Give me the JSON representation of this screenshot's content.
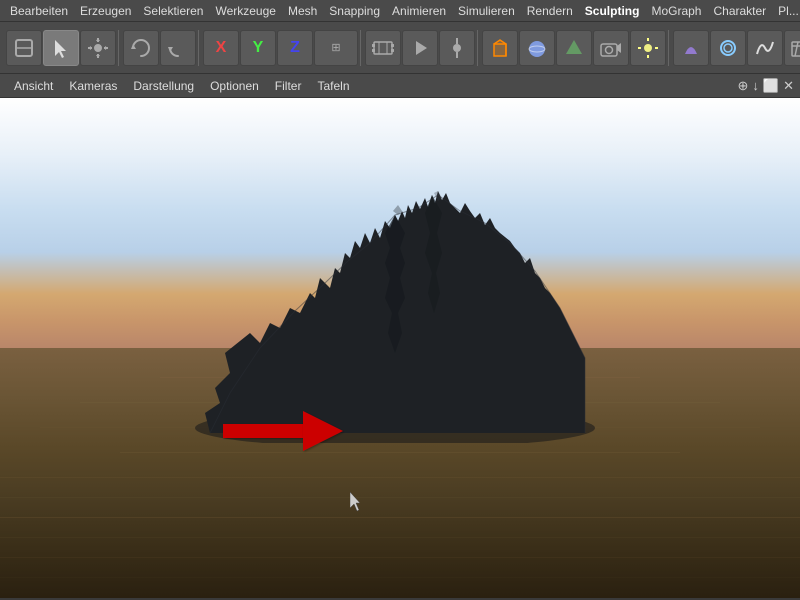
{
  "menubar": {
    "items": [
      {
        "label": "Bearbeiten",
        "id": "bearbeiten"
      },
      {
        "label": "Erzeugen",
        "id": "erzeugen"
      },
      {
        "label": "Selektieren",
        "id": "selektieren"
      },
      {
        "label": "Werkzeuge",
        "id": "werkzeuge"
      },
      {
        "label": "Mesh",
        "id": "mesh"
      },
      {
        "label": "Snapping",
        "id": "snapping"
      },
      {
        "label": "Animieren",
        "id": "animieren"
      },
      {
        "label": "Simulieren",
        "id": "simulieren"
      },
      {
        "label": "Rendern",
        "id": "rendern"
      },
      {
        "label": "Sculpting",
        "id": "sculpting"
      },
      {
        "label": "MoGraph",
        "id": "mograph"
      },
      {
        "label": "Charakter",
        "id": "charakter"
      },
      {
        "label": "Pl...",
        "id": "plugins"
      }
    ]
  },
  "viewtoolbar": {
    "items": [
      {
        "label": "Ansicht"
      },
      {
        "label": "Kameras"
      },
      {
        "label": "Darstellung"
      },
      {
        "label": "Optionen"
      },
      {
        "label": "Filter"
      },
      {
        "label": "Tafeln"
      }
    ]
  },
  "toolbar": {
    "tools": []
  },
  "viewport": {
    "description": "3D viewport showing a dark mountain/island rising from water with sunset sky"
  }
}
